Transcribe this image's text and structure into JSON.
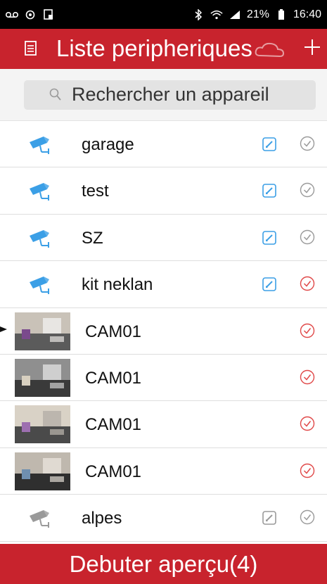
{
  "status_bar": {
    "battery": "21%",
    "time": "16:40"
  },
  "header": {
    "title": "Liste peripheriques"
  },
  "search": {
    "placeholder": "Rechercher un appareil"
  },
  "devices": [
    {
      "name": "garage",
      "icon": "camera-icon",
      "editable": true,
      "checked": false,
      "has_thumbnail": false
    },
    {
      "name": "test",
      "icon": "camera-icon",
      "editable": true,
      "checked": false,
      "has_thumbnail": false
    },
    {
      "name": "SZ",
      "icon": "camera-icon",
      "editable": true,
      "checked": false,
      "has_thumbnail": false
    },
    {
      "name": "kit neklan",
      "icon": "camera-icon",
      "editable": true,
      "checked": true,
      "has_thumbnail": false
    },
    {
      "name": "CAM01",
      "icon": "thumbnail",
      "editable": false,
      "checked": true,
      "has_thumbnail": true
    },
    {
      "name": "CAM01",
      "icon": "thumbnail",
      "editable": false,
      "checked": true,
      "has_thumbnail": true
    },
    {
      "name": "CAM01",
      "icon": "thumbnail",
      "editable": false,
      "checked": true,
      "has_thumbnail": true
    },
    {
      "name": "CAM01",
      "icon": "thumbnail",
      "editable": false,
      "checked": true,
      "has_thumbnail": true
    },
    {
      "name": "alpes",
      "icon": "camera-icon-gray",
      "editable": true,
      "checked": false,
      "has_thumbnail": false
    }
  ],
  "footer": {
    "start_preview_label": "Debuter aperçu(4)"
  },
  "colors": {
    "brand_red": "#c8232d",
    "camera_blue": "#3b9fe6",
    "checked_red": "#e04848",
    "unchecked_gray": "#9a9a9a"
  }
}
